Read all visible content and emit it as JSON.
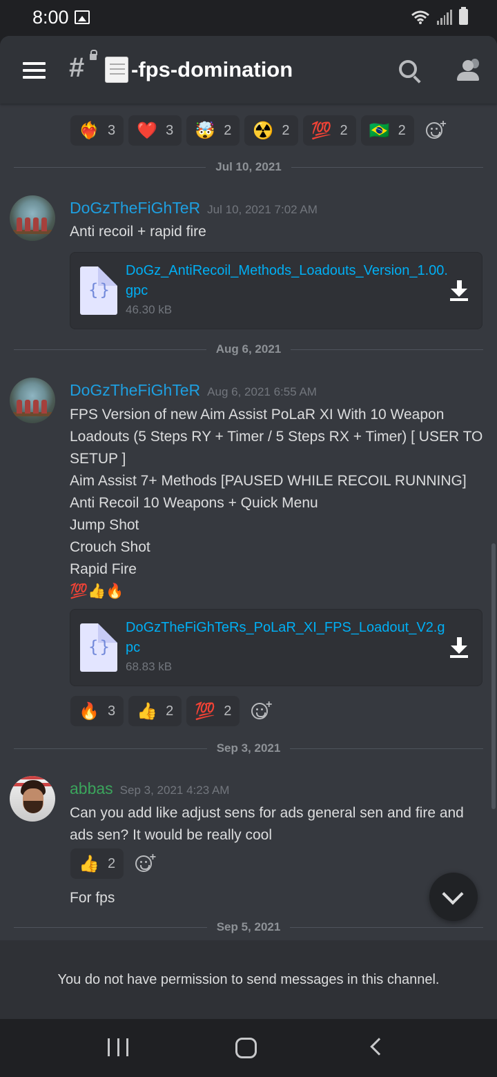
{
  "status_bar": {
    "time": "8:00"
  },
  "header": {
    "channel_name": "-fps-domination",
    "channel_emoji": "scroll-icon"
  },
  "top_reactions": [
    {
      "emoji": "❤️‍🔥",
      "count": "3"
    },
    {
      "emoji": "❤️",
      "count": "3"
    },
    {
      "emoji": "🤯",
      "count": "2"
    },
    {
      "emoji": "☢️",
      "count": "2"
    },
    {
      "emoji": "💯",
      "count": "2"
    },
    {
      "emoji": "🇧🇷",
      "count": "2"
    }
  ],
  "dividers": [
    "Jul 10, 2021",
    "Aug 6, 2021",
    "Sep 3, 2021",
    "Sep 5, 2021"
  ],
  "messages": [
    {
      "username": "DoGzTheFiGhTeR",
      "timestamp": "Jul 10, 2021 7:02 AM",
      "text": "Anti recoil + rapid fire",
      "attachment": {
        "name": "DoGz_AntiRecoil_Methods_Loadouts_Version_1.00.gpc",
        "size": "46.30 kB"
      }
    },
    {
      "username": "DoGzTheFiGhTeR",
      "timestamp": "Aug 6, 2021 6:55 AM",
      "text": "FPS Version of new Aim Assist PoLaR XI With 10 Weapon Loadouts (5 Steps RY + Timer / 5 Steps RX + Timer)  [ USER TO SETUP ]\nAim Assist 7+ Methods [PAUSED WHILE RECOIL RUNNING]\nAnti Recoil 10 Weapons + Quick Menu\nJump Shot\nCrouch Shot\nRapid Fire\n💯👍🔥",
      "attachment": {
        "name": "DoGzTheFiGhTeRs_PoLaR_XI_FPS_Loadout_V2.gpc",
        "size": "68.83 kB"
      },
      "reactions": [
        {
          "emoji": "🔥",
          "count": "3"
        },
        {
          "emoji": "👍",
          "count": "2"
        },
        {
          "emoji": "💯",
          "count": "2"
        }
      ]
    },
    {
      "username": "abbas",
      "timestamp": "Sep 3, 2021 4:23 AM",
      "text": "Can you add like adjust sens for ads general sen and fire and ads sen? It would be really cool",
      "reactions": [
        {
          "emoji": "👍",
          "count": "2"
        }
      ],
      "followup": "For fps"
    }
  ],
  "footer": {
    "notice": "You do not have permission to send messages in this channel."
  }
}
